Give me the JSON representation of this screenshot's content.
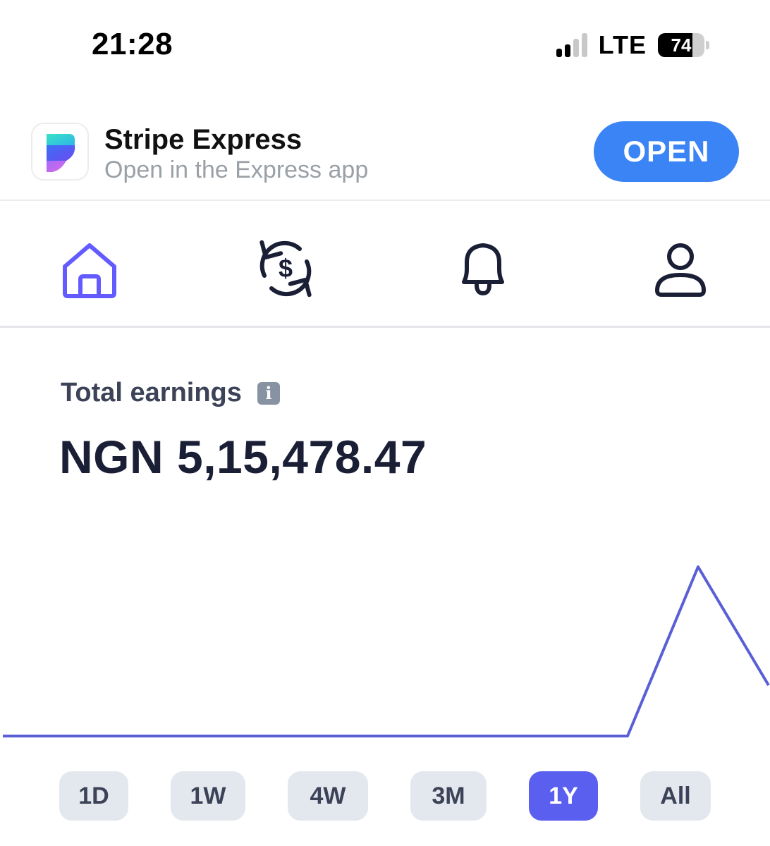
{
  "status_bar": {
    "time": "21:28",
    "network": "LTE",
    "battery": "74",
    "battery_level": 0.74
  },
  "banner": {
    "app_name": "Stripe Express",
    "subtitle": "Open in the Express app",
    "open_label": "OPEN",
    "accent": "#3a84f6"
  },
  "nav": {
    "items": [
      {
        "icon": "home-icon",
        "active": true
      },
      {
        "icon": "currency-exchange-icon",
        "active": false
      },
      {
        "icon": "bell-icon",
        "active": false
      },
      {
        "icon": "person-icon",
        "active": false
      }
    ],
    "active_color": "#635bff"
  },
  "earnings": {
    "label": "Total earnings",
    "value": "NGN 5,15,478.47"
  },
  "chart_data": {
    "type": "line",
    "x": [
      0,
      1,
      2,
      3,
      4,
      5,
      6,
      7,
      8,
      9,
      10,
      11,
      12
    ],
    "series": [
      {
        "values": [
          0,
          0,
          0,
          0,
          0,
          0,
          0,
          0,
          0,
          0,
          0,
          1,
          0.3
        ]
      }
    ],
    "ylim": [
      0,
      1
    ],
    "color": "#5a5fd6",
    "grid": false
  },
  "ranges": {
    "options": [
      "1D",
      "1W",
      "4W",
      "3M",
      "1Y",
      "All"
    ],
    "selected": "1Y"
  }
}
